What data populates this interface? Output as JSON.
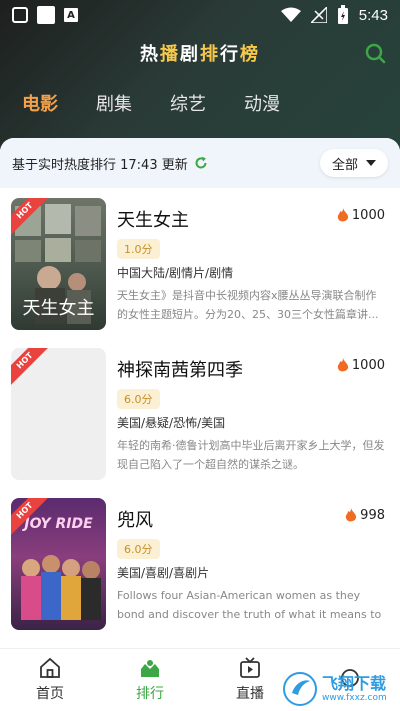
{
  "status_bar": {
    "time": "5:43",
    "a_label": "A"
  },
  "header": {
    "title_parts": [
      "热",
      "播",
      "剧",
      "排",
      "行",
      "榜"
    ],
    "tabs": [
      "电影",
      "剧集",
      "综艺",
      "动漫"
    ]
  },
  "rank_bar": {
    "text": "基于实时热度排行 17:43 更新",
    "filter": "全部"
  },
  "items": [
    {
      "badge": "HOT",
      "title": "天生女主",
      "heat": "1000",
      "score": "1.0分",
      "genre": "中国大陆/剧情片/剧情",
      "desc": "天生女主》是抖音中长视频内容x腰丛丛导演联合制作的女性主题短片。分为20、25、30三个女性篇章讲...",
      "poster_text": "天生女主"
    },
    {
      "badge": "HOT",
      "title": "神探南茜第四季",
      "heat": "1000",
      "score": "6.0分",
      "genre": "美国/悬疑/恐怖/美国",
      "desc": "年轻的南希·德鲁计划高中毕业后离开家乡上大学，但发现自己陷入了一个超自然的谋杀之谜。",
      "poster_text": ""
    },
    {
      "badge": "HOT",
      "title": "兜风",
      "heat": "998",
      "score": "6.0分",
      "genre": "美国/喜剧/喜剧片",
      "desc": "Follows four Asian-American women as they bond and discover the truth of what it means to know an...",
      "poster_text": "JOY RIDE"
    }
  ],
  "nav": [
    {
      "label": "首页",
      "icon": "home-icon"
    },
    {
      "label": "排行",
      "icon": "rank-icon"
    },
    {
      "label": "直播",
      "icon": "tv-icon"
    },
    {
      "label": "",
      "icon": "more-icon"
    }
  ],
  "watermark": {
    "text": "飞翔下载",
    "sub": "www.fxxz.com"
  },
  "colors": {
    "accent": "#3ca845",
    "tab_active": "#f2a04a",
    "hot": "#e8433f"
  }
}
